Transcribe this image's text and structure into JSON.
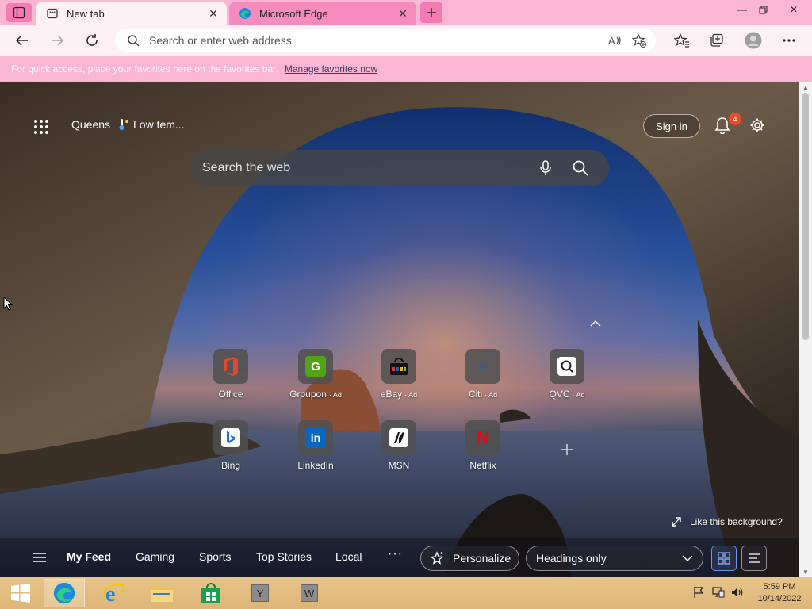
{
  "browser": {
    "tabs": [
      {
        "title": "New tab",
        "active": true
      },
      {
        "title": "Microsoft Edge",
        "active": false
      }
    ],
    "address_placeholder": "Search or enter web address",
    "favorites_hint": "For quick access, place your favorites here on the favorites bar.",
    "favorites_link": "Manage favorites now",
    "accent": "#fbb6d3"
  },
  "ntp": {
    "location": "Queens",
    "weather": "Low tem...",
    "signin_label": "Sign in",
    "notification_count": "4",
    "search_placeholder": "Search the web",
    "tiles": [
      {
        "label": "Office",
        "ad": ""
      },
      {
        "label": "Groupon",
        "ad": "· Ad"
      },
      {
        "label": "eBay",
        "ad": "· Ad"
      },
      {
        "label": "Citi",
        "ad": "· Ad"
      },
      {
        "label": "QVC",
        "ad": "· Ad"
      },
      {
        "label": "Bing",
        "ad": ""
      },
      {
        "label": "LinkedIn",
        "ad": ""
      },
      {
        "label": "MSN",
        "ad": ""
      },
      {
        "label": "Netflix",
        "ad": ""
      }
    ],
    "like_background": "Like this background?",
    "feed": {
      "tabs": [
        "My Feed",
        "Gaming",
        "Sports",
        "Top Stories",
        "Local"
      ],
      "more": "···",
      "personalize": "Personalize",
      "view_select": "Headings only"
    }
  },
  "taskbar": {
    "pinned": [
      "start",
      "edge",
      "internet-explorer",
      "file-explorer",
      "store",
      "Y",
      "W"
    ],
    "time": "5:59 PM",
    "date": "10/14/2022"
  }
}
